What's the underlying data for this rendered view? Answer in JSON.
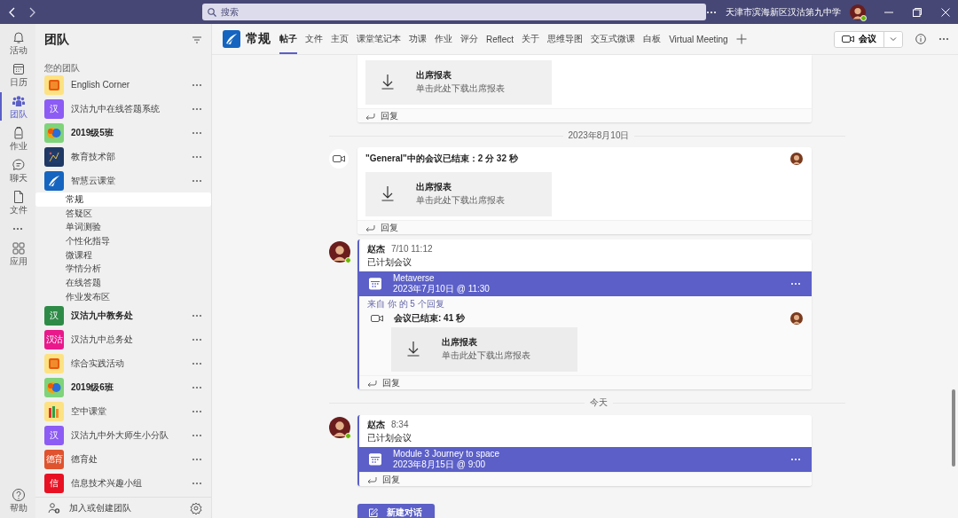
{
  "title_bar": {
    "search": {
      "placeholder": "搜索"
    },
    "org_name": "天津市滨海新区汉沽第九中学",
    "user_online": true
  },
  "rail": [
    {
      "label": "活动",
      "selected": false
    },
    {
      "label": "日历",
      "selected": false
    },
    {
      "label": "团队",
      "selected": true
    },
    {
      "label": "作业",
      "selected": false
    },
    {
      "label": "聊天",
      "selected": false
    },
    {
      "label": "文件",
      "selected": false
    },
    {
      "label": "应用",
      "selected": false
    }
  ],
  "rail_help": {
    "label": "帮助"
  },
  "sidebar": {
    "title": "团队",
    "section_label": "您的团队",
    "teams": [
      {
        "name": "English Corner",
        "kind": "square",
        "color": "#fde283",
        "unread": false
      },
      {
        "name": "汉沽九中在线答题系统",
        "kind": "letters",
        "icon_text": "汉",
        "color": "#8c5cf4",
        "unread": false
      },
      {
        "name": "2019级5班",
        "kind": "bubbles",
        "color": "#7fd37a",
        "unread": true
      },
      {
        "name": "教育技术部",
        "kind": "image",
        "color": "#1f3864",
        "unread": false
      },
      {
        "name": "智慧云课堂",
        "kind": "logo",
        "color": "#1565c0",
        "unread": false,
        "channels": [
          {
            "name": "常规",
            "selected": true
          },
          {
            "name": "答疑区",
            "selected": false
          },
          {
            "name": "单词测验",
            "selected": false
          },
          {
            "name": "个性化指导",
            "selected": false
          },
          {
            "name": "微课程",
            "selected": false
          },
          {
            "name": "学情分析",
            "selected": false
          },
          {
            "name": "在线答题",
            "selected": false
          },
          {
            "name": "作业发布区",
            "selected": false
          }
        ]
      },
      {
        "name": "汉沽九中教务处",
        "kind": "letters",
        "icon_text": "汉",
        "color": "#2e8b47",
        "unread": true
      },
      {
        "name": "汉沽九中总务处",
        "kind": "letters",
        "icon_text": "汉沽",
        "color": "#e9198b",
        "unread": false
      },
      {
        "name": "综合实践活动",
        "kind": "square",
        "color": "#fde283",
        "unread": false
      },
      {
        "name": "2019级6班",
        "kind": "bubbles",
        "color": "#7fd37a",
        "unread": true
      },
      {
        "name": "空中课堂",
        "kind": "books",
        "color": "#fde283",
        "unread": false
      },
      {
        "name": "汉沽九中外大师生小分队",
        "kind": "letters",
        "icon_text": "汉",
        "color": "#8c5cf4",
        "unread": false
      },
      {
        "name": "德育处",
        "kind": "letters",
        "icon_text": "德育",
        "color": "#e0532f",
        "unread": false
      },
      {
        "name": "信息技术兴趣小组",
        "kind": "letters",
        "icon_text": "信",
        "color": "#e81123",
        "unread": false
      }
    ],
    "footer": "加入或创建团队"
  },
  "channel_header": {
    "title": "常规",
    "tabs": [
      {
        "label": "帖子",
        "selected": true
      },
      {
        "label": "文件",
        "selected": false
      },
      {
        "label": "主页",
        "selected": false
      },
      {
        "label": "课堂笔记本",
        "selected": false
      },
      {
        "label": "功课",
        "selected": false
      },
      {
        "label": "作业",
        "selected": false
      },
      {
        "label": "评分",
        "selected": false
      },
      {
        "label": "Reflect",
        "selected": false
      },
      {
        "label": "关于",
        "selected": false
      },
      {
        "label": "思维导图",
        "selected": false
      },
      {
        "label": "交互式微课",
        "selected": false
      },
      {
        "label": "白板",
        "selected": false
      },
      {
        "label": "Virtual Meeting",
        "selected": false
      }
    ],
    "meet_button": "会议"
  },
  "feed": [
    {
      "kind": "meeting_ended",
      "attendance": {
        "title": "出席报表",
        "subtitle": "单击此处下载出席报表"
      },
      "reply": "回复"
    },
    {
      "kind": "divider",
      "label": "2023年8月10日"
    },
    {
      "kind": "meeting_ended",
      "title": "\"General\"中的会议已结束：2 分 32 秒",
      "attendance": {
        "title": "出席报表",
        "subtitle": "单击此处下载出席报表"
      },
      "reply": "回复"
    },
    {
      "kind": "post",
      "author": "赵杰",
      "time": "7/10 11:12",
      "text": "已计划会议",
      "online": true,
      "meeting": {
        "title": "Metaverse",
        "when": "2023年7月10日 @ 11:30"
      },
      "replies_link": "来自 你 的 5 个回复",
      "replies": [
        {
          "title": "会议已结束: 41 秒",
          "attendance": {
            "title": "出席报表",
            "subtitle": "单击此处下载出席报表"
          }
        }
      ],
      "reply": "回复"
    },
    {
      "kind": "divider",
      "label": "今天"
    },
    {
      "kind": "post",
      "author": "赵杰",
      "time": "8:34",
      "text": "已计划会议",
      "online": true,
      "meeting": {
        "title": "Module 3 Journey to space",
        "when": "2023年8月15日 @ 9:00"
      },
      "reply": "回复"
    }
  ],
  "new_conversation_button": "新建对话"
}
